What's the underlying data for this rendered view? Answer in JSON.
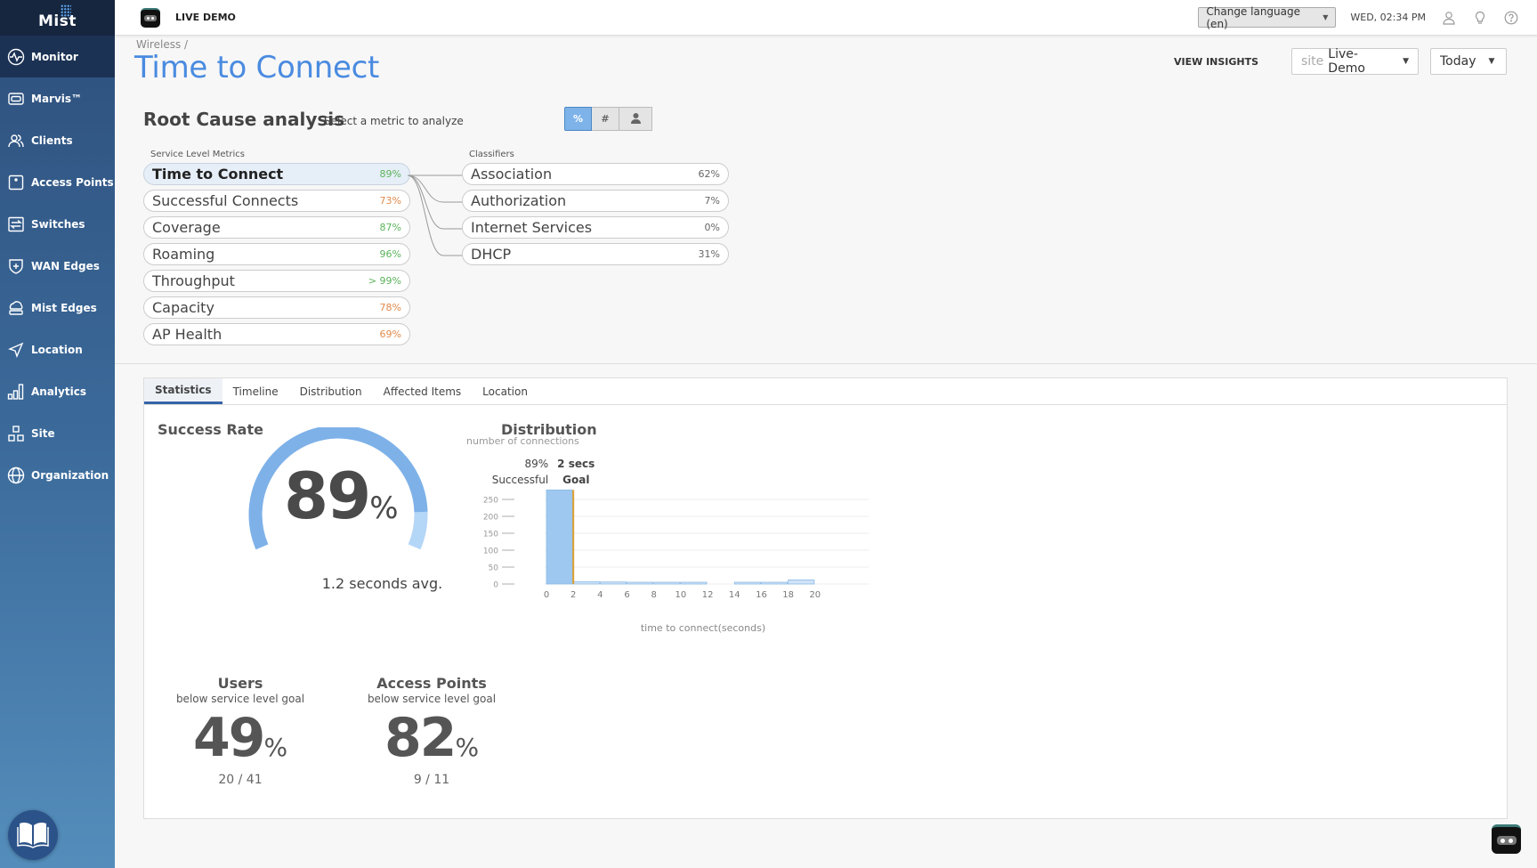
{
  "app": {
    "logo": "Mist"
  },
  "sidebar": {
    "items": [
      {
        "label": "Monitor",
        "icon": "monitor-icon",
        "active": true
      },
      {
        "label": "Marvis™",
        "icon": "marvis-icon"
      },
      {
        "label": "Clients",
        "icon": "clients-icon"
      },
      {
        "label": "Access Points",
        "icon": "access-point-icon"
      },
      {
        "label": "Switches",
        "icon": "switch-icon"
      },
      {
        "label": "WAN Edges",
        "icon": "wan-edge-icon"
      },
      {
        "label": "Mist Edges",
        "icon": "mist-edge-icon"
      },
      {
        "label": "Location",
        "icon": "location-icon"
      },
      {
        "label": "Analytics",
        "icon": "analytics-icon"
      },
      {
        "label": "Site",
        "icon": "site-icon"
      },
      {
        "label": "Organization",
        "icon": "organization-icon"
      }
    ]
  },
  "header": {
    "org_name": "LIVE DEMO",
    "language_select": "Change language (en)",
    "datetime": "WED, 02:34 PM"
  },
  "page": {
    "breadcrumb": "Wireless /",
    "title": "Time to Connect",
    "view_insights": "VIEW INSIGHTS",
    "site_prefix": "site",
    "site_value": "Live-Demo",
    "date_value": "Today"
  },
  "rca": {
    "title": "Root Cause analysis",
    "subtitle": "Select a metric to analyze",
    "toggles": [
      {
        "label": "%",
        "active": true
      },
      {
        "label": "#"
      },
      {
        "label": "user-icon"
      }
    ],
    "metrics_label": "Service Level Metrics",
    "metrics": [
      {
        "label": "Time to Connect",
        "value": "89%",
        "status": "green",
        "active": true
      },
      {
        "label": "Successful Connects",
        "value": "73%",
        "status": "orange"
      },
      {
        "label": "Coverage",
        "value": "87%",
        "status": "green"
      },
      {
        "label": "Roaming",
        "value": "96%",
        "status": "green"
      },
      {
        "label": "Throughput",
        "value": "> 99%",
        "status": "green"
      },
      {
        "label": "Capacity",
        "value": "78%",
        "status": "orange"
      },
      {
        "label": "AP Health",
        "value": "69%",
        "status": "orange"
      }
    ],
    "classifiers_label": "Classifiers",
    "classifiers": [
      {
        "label": "Association",
        "value": "62%"
      },
      {
        "label": "Authorization",
        "value": "7%"
      },
      {
        "label": "Internet Services",
        "value": "0%"
      },
      {
        "label": "DHCP",
        "value": "31%"
      }
    ]
  },
  "tabs": [
    {
      "label": "Statistics",
      "active": true
    },
    {
      "label": "Timeline"
    },
    {
      "label": "Distribution"
    },
    {
      "label": "Affected Items"
    },
    {
      "label": "Location"
    }
  ],
  "stats": {
    "success_rate_title": "Success Rate",
    "success_rate_value": "89",
    "success_rate_fraction": 0.89,
    "pct_symbol": "%",
    "avg_text": "1.2 seconds avg.",
    "distribution_title": "Distribution",
    "users": {
      "title": "Users",
      "subtitle": "below service level goal",
      "value": "49",
      "ratio": "20 / 41"
    },
    "access_points": {
      "title": "Access Points",
      "subtitle": "below service level goal",
      "value": "82",
      "ratio": "9 / 11"
    }
  },
  "colors": {
    "accent": "#4a8be0",
    "bar": "#9ec8f0",
    "goal_line": "#e0a030",
    "green": "#5bb35b",
    "orange": "#e08a4b"
  },
  "chart_data": {
    "type": "bar",
    "title": "Distribution",
    "ylabel": "number of connections",
    "xlabel": "time to connect(seconds)",
    "ylim": [
      0,
      250
    ],
    "yticks": [
      0,
      50,
      100,
      150,
      200,
      250
    ],
    "xticks": [
      0,
      2,
      4,
      6,
      8,
      10,
      12,
      14,
      16,
      18,
      20
    ],
    "bins": [
      {
        "from": 0,
        "to": 2,
        "value": 278
      },
      {
        "from": 2,
        "to": 4,
        "value": 7
      },
      {
        "from": 4,
        "to": 6,
        "value": 6
      },
      {
        "from": 6,
        "to": 8,
        "value": 4
      },
      {
        "from": 8,
        "to": 10,
        "value": 3
      },
      {
        "from": 10,
        "to": 12,
        "value": 3
      },
      {
        "from": 12,
        "to": 14,
        "value": 0
      },
      {
        "from": 14,
        "to": 16,
        "value": 3
      },
      {
        "from": 16,
        "to": 18,
        "value": 3
      },
      {
        "from": 18,
        "to": 20,
        "value": 12
      }
    ],
    "goal": {
      "x": 2,
      "label_value": "2 secs",
      "label": "Goal"
    },
    "successful": {
      "value": "89%",
      "label": "Successful"
    }
  }
}
